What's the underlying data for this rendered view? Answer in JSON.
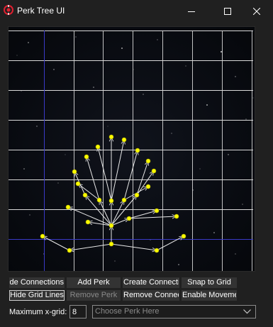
{
  "window": {
    "title": "Perk Tree UI"
  },
  "toolbar": {
    "row1": {
      "hide_connections": "Hide Connections",
      "add_perk": "Add Perk",
      "create_connection": "Create Connection",
      "snap_to_grid": "Snap to Grid"
    },
    "row2": {
      "hide_grid_lines": "Hide Grid Lines",
      "remove_perk": "Remove Perk",
      "remove_connection": "Remove Connection",
      "enable_movement": "Enable Movement"
    }
  },
  "settings": {
    "max_x_grid_label": "Maximum x-grid:",
    "max_x_grid_value": "8",
    "perk_select_placeholder": "Choose Perk Here"
  },
  "colors": {
    "background": "#202020",
    "grid_line": "#d8d8d8",
    "grid_axis": "#3a3ac8",
    "perk_node": "#ffff00",
    "connection": "#e8e8e8"
  },
  "icons": {
    "app": "app-icon",
    "minimize": "minimize-icon",
    "maximize": "maximize-icon",
    "close": "close-icon",
    "dropdown": "chevron-down-icon"
  }
}
